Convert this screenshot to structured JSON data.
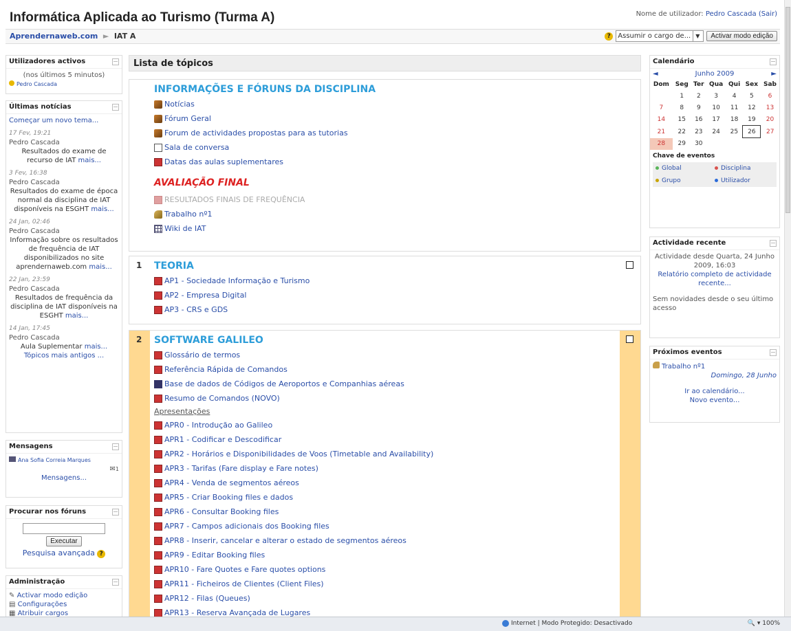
{
  "header": {
    "title": "Informática Aplicada ao Turismo (Turma A)",
    "login_prefix": "Nome de utilizador:",
    "user": "Pedro Cascada",
    "logout": "(Sair)"
  },
  "nav": {
    "home": "Aprendernaweb.com",
    "sep": "►",
    "current": "IAT A",
    "role_select": "Assumir o cargo de...",
    "edit_button": "Activar modo edição"
  },
  "active_users": {
    "title": "Utilizadores activos",
    "period": "(nos últimos 5 minutos)",
    "user": "Pedro Cascada"
  },
  "news": {
    "title": "Últimas notícias",
    "new_topic": "Começar um novo tema...",
    "items": [
      {
        "date": "17 Fev, 19:21",
        "author": "Pedro Cascada",
        "text": "Resultados do exame de recurso de IAT",
        "more": "mais..."
      },
      {
        "date": "3 Fev, 16:38",
        "author": "Pedro Cascada",
        "text": "Resultados do exame de época normal da disciplina de IAT disponíveis na ESGHT",
        "more": "mais..."
      },
      {
        "date": "24 Jan, 02:46",
        "author": "Pedro Cascada",
        "text": "Informação sobre os resultados de frequência de IAT disponibilizados no site aprendernaweb.com",
        "more": "mais..."
      },
      {
        "date": "22 Jan, 23:59",
        "author": "Pedro Cascada",
        "text": "Resultados de frequência da disciplina de IAT disponíveis na ESGHT",
        "more": "mais..."
      },
      {
        "date": "14 Jan, 17:45",
        "author": "Pedro Cascada",
        "text": "Aula Suplementar",
        "more": "mais..."
      }
    ],
    "older": "Tópicos mais antigos ..."
  },
  "messages": {
    "title": "Mensagens",
    "sender": "Ana Sofia Correia Marques",
    "count": "1",
    "link": "Mensagens..."
  },
  "search": {
    "title": "Procurar nos fóruns",
    "button": "Executar",
    "advanced": "Pesquisa avançada"
  },
  "admin": {
    "title": "Administração",
    "items": [
      "Activar modo edição",
      "Configurações",
      "Atribuir cargos"
    ]
  },
  "main": {
    "title": "Lista de tópicos",
    "section0": {
      "title": "INFORMAÇÕES E FÓRUNS DA DISCIPLINA",
      "items": [
        {
          "label": "Notícias",
          "icon": "forum-icon"
        },
        {
          "label": "Fórum Geral",
          "icon": "forum-icon"
        },
        {
          "label": "Forum de actividades propostas para as tutorias",
          "icon": "forum-icon"
        },
        {
          "label": "Sala de conversa",
          "icon": "chat-icon"
        },
        {
          "label": "Datas das aulas suplementares",
          "icon": "pdf-icon"
        }
      ],
      "title2": "AVALIAÇÃO FINAL",
      "items2": [
        {
          "label": "RESULTADOS FINAIS DE FREQUÊNCIA",
          "icon": "pdf-icon"
        },
        {
          "label": "Trabalho nº1",
          "icon": "assignment-icon"
        },
        {
          "label": "Wiki de IAT",
          "icon": "wiki-icon"
        }
      ]
    },
    "section1": {
      "num": "1",
      "title": "TEORIA",
      "items": [
        "AP1 - Sociedade Informação e Turismo",
        "AP2 - Empresa Digital",
        "AP3 - CRS e GDS"
      ]
    },
    "section2": {
      "num": "2",
      "title": "SOFTWARE GALILEO",
      "items": [
        {
          "label": "Glossário de termos",
          "icon": "pdf-icon"
        },
        {
          "label": "Referência Rápida de Comandos",
          "icon": "pdf-icon"
        },
        {
          "label": "Base de dados de Códigos de Aeroportos e Companhias aéreas",
          "icon": "database-icon"
        },
        {
          "label": "Resumo de Comandos (NOVO)",
          "icon": "pdf-icon"
        }
      ],
      "subhead": "Apresentações",
      "presentations": [
        "APR0 - Introdução ao Galileo",
        "APR1 - Codificar e Descodificar",
        "APR2 - Horários e Disponibilidades de Voos (Timetable and Availability)",
        "APR3 - Tarifas (Fare display e Fare notes)",
        "APR4 - Venda de segmentos aéreos",
        "APR5 - Criar Booking files e dados",
        "APR6 - Consultar Booking files",
        "APR7 - Campos adicionais dos Booking files",
        "APR8 - Inserir, cancelar e alterar o estado de segmentos aéreos",
        "APR9 - Editar Booking files",
        "APR10 - Fare Quotes e Fare quotes options",
        "APR11 - Ficheiros de Clientes (Client Files)",
        "APR12 - Filas (Queues)",
        "APR13 - Reserva Avançada de Lugares"
      ]
    }
  },
  "calendar": {
    "title": "Calendário",
    "prev": "◄",
    "next": "►",
    "month": "Junho 2009",
    "days": [
      "Dom",
      "Seg",
      "Ter",
      "Qua",
      "Qui",
      "Sex",
      "Sab"
    ],
    "weeks": [
      [
        "",
        "1",
        "2",
        "3",
        "4",
        "5",
        "6"
      ],
      [
        "7",
        "8",
        "9",
        "10",
        "11",
        "12",
        "13"
      ],
      [
        "14",
        "15",
        "16",
        "17",
        "18",
        "19",
        "20"
      ],
      [
        "21",
        "22",
        "23",
        "24",
        "25",
        "26",
        "27"
      ],
      [
        "28",
        "29",
        "30",
        "",
        "",
        "",
        ""
      ]
    ],
    "today": "26",
    "event_day": "28",
    "key_title": "Chave de eventos",
    "keys": [
      {
        "label": "Global",
        "color": "#5ab55a"
      },
      {
        "label": "Disciplina",
        "color": "#d9534f"
      },
      {
        "label": "Grupo",
        "color": "#c9a400"
      },
      {
        "label": "Utilizador",
        "color": "#2a6ad9"
      }
    ]
  },
  "recent": {
    "title": "Actividade recente",
    "since": "Actividade desde Quarta, 24 Junho 2009, 16:03",
    "report": "Relatório completo de actividade recente...",
    "none": "Sem novidades desde o seu último acesso"
  },
  "upcoming": {
    "title": "Próximos eventos",
    "event": "Trabalho nº1",
    "date": "Domingo, 28 Junho",
    "goto": "Ir ao calendário...",
    "new": "Novo evento..."
  },
  "status": {
    "zone": "Internet | Modo Protegido: Desactivado",
    "zoom": "100%"
  }
}
